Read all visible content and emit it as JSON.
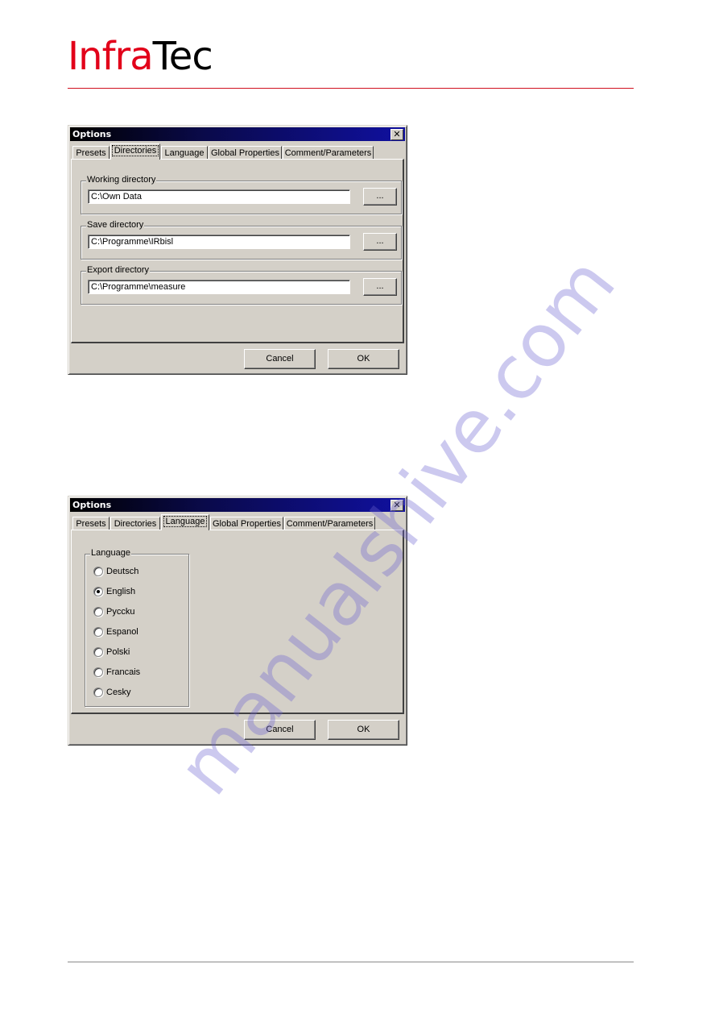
{
  "header": {
    "logo_part1": "Infra",
    "logo_part2": "Tec",
    "brand_color": "#e2001a"
  },
  "dialog1": {
    "title": "Options",
    "tabs": [
      {
        "label": "Presets",
        "active": false
      },
      {
        "label": "Directories",
        "active": true
      },
      {
        "label": "Language",
        "active": false
      },
      {
        "label": "Global Properties",
        "active": false
      },
      {
        "label": "Comment/Parameters",
        "active": false
      }
    ],
    "groups": [
      {
        "label": "Working directory",
        "value": "C:\\Own Data",
        "browse_label": "..."
      },
      {
        "label": "Save directory",
        "value": "C:\\Programme\\IRbisl",
        "browse_label": "..."
      },
      {
        "label": "Export directory",
        "value": "C:\\Programme\\measure",
        "browse_label": "..."
      }
    ],
    "cancel_label": "Cancel",
    "ok_label": "OK"
  },
  "dialog2": {
    "title": "Options",
    "tabs": [
      {
        "label": "Presets",
        "active": false
      },
      {
        "label": "Directories",
        "active": false
      },
      {
        "label": "Language",
        "active": true
      },
      {
        "label": "Global Properties",
        "active": false
      },
      {
        "label": "Comment/Parameters",
        "active": false
      }
    ],
    "language_group_label": "Language",
    "languages": [
      {
        "label": "Deutsch",
        "checked": false
      },
      {
        "label": "English",
        "checked": true
      },
      {
        "label": "Pyccku",
        "checked": false
      },
      {
        "label": "Espanol",
        "checked": false
      },
      {
        "label": "Polski",
        "checked": false
      },
      {
        "label": "Francais",
        "checked": false
      },
      {
        "label": "Cesky",
        "checked": false
      }
    ],
    "cancel_label": "Cancel",
    "ok_label": "OK"
  },
  "watermark": "manualshive.com"
}
